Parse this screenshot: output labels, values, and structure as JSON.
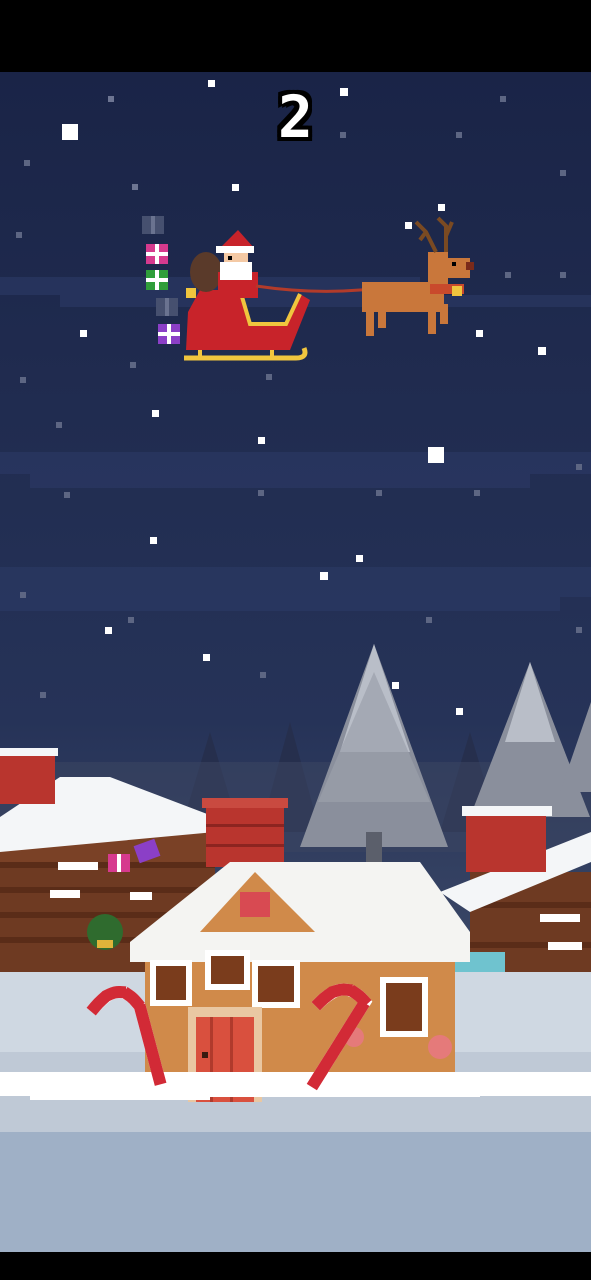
{
  "hud": {
    "score": "2"
  },
  "colors": {
    "sky_top": "#1b2548",
    "sky_mid": "#243056",
    "ground": "#cfd8e2",
    "snow": "#ffffff",
    "sleigh": "#c8232a",
    "reindeer": "#c9773b",
    "gingerbread": "#d08a4a",
    "brick": "#b9352e"
  },
  "icons": [
    "santa-icon",
    "sleigh-icon",
    "reindeer-icon",
    "gift-icon",
    "gingerbread-house-icon",
    "pine-tree-icon",
    "chimney-icon",
    "candy-cane-icon"
  ]
}
